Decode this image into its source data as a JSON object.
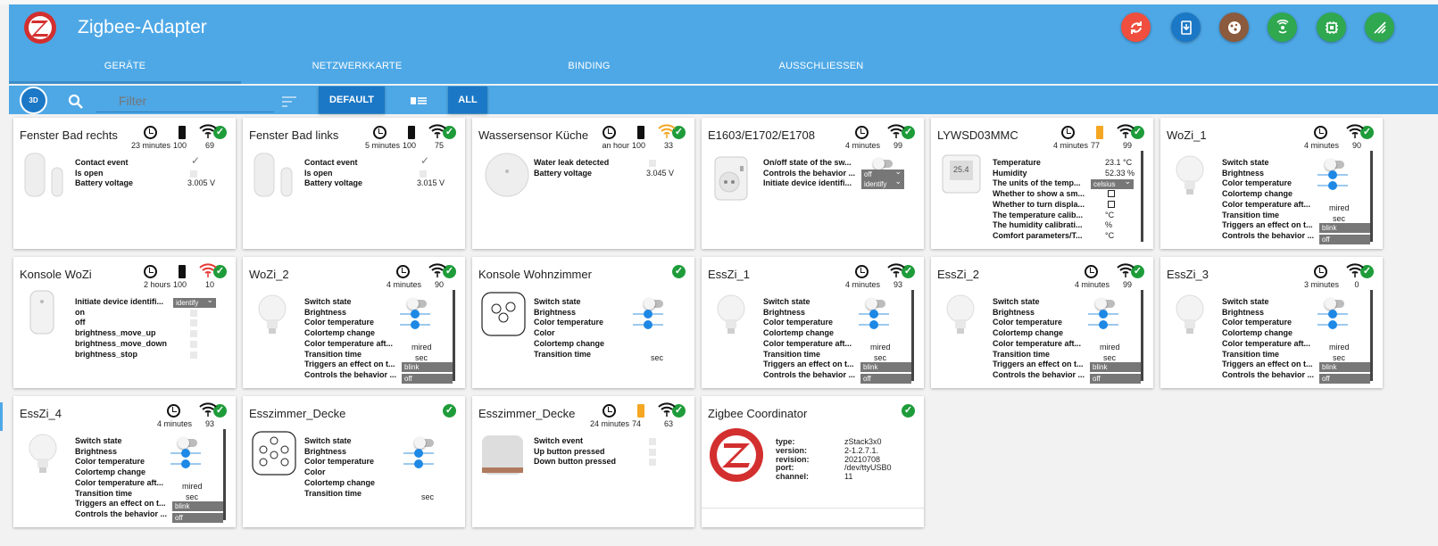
{
  "app": {
    "title": "Zigbee-Adapter"
  },
  "tabs": [
    "GERÄTE",
    "NETZWERKKARTE",
    "BINDING",
    "AUSSCHLIESSEN"
  ],
  "header_buttons": [
    {
      "name": "refresh-button",
      "icon": "refresh-icon",
      "color": "#f04e3e"
    },
    {
      "name": "install-button",
      "icon": "download-device-icon",
      "color": "#1b78c6"
    },
    {
      "name": "cookie-button",
      "icon": "cookie-icon",
      "color": "#8c5a3c"
    },
    {
      "name": "pairing-button",
      "icon": "pairing-icon",
      "color": "#2fa84f"
    },
    {
      "name": "chip-button",
      "icon": "chip-icon",
      "color": "#2fa84f"
    },
    {
      "name": "info-button",
      "icon": "signal-icon",
      "color": "#2fa84f"
    }
  ],
  "toolbar": {
    "filter_placeholder": "Filter",
    "default_label": "DEFAULT",
    "all_label": "ALL",
    "cube_label": "3D"
  },
  "colors": {
    "header": "#4ea8e6",
    "button": "#1b78c6",
    "ok": "#1e9c3a",
    "battery_low": "#f5a623",
    "wifi_orange": "#f5a623",
    "wifi_red": "#e53935"
  },
  "cards": [
    {
      "name": "Fenster Bad rechts",
      "status_time": "23 minutes",
      "battery": "100",
      "link": "69",
      "wifi_color": "#111",
      "battery_color": "#111",
      "image": "contact",
      "states": [
        {
          "label": "Contact event",
          "kind": "check"
        },
        {
          "label": "Is open",
          "kind": "box"
        },
        {
          "label": "Battery voltage",
          "kind": "text",
          "value": "3.005 V"
        }
      ]
    },
    {
      "name": "Fenster Bad links",
      "status_time": "5 minutes",
      "battery": "100",
      "link": "75",
      "wifi_color": "#111",
      "battery_color": "#111",
      "image": "contact",
      "states": [
        {
          "label": "Contact event",
          "kind": "check"
        },
        {
          "label": "Is open",
          "kind": "box"
        },
        {
          "label": "Battery voltage",
          "kind": "text",
          "value": "3.015 V"
        }
      ]
    },
    {
      "name": "Wassersensor Küche",
      "status_time": "an hour",
      "battery": "100",
      "link": "33",
      "wifi_color": "#f5a623",
      "battery_color": "#111",
      "image": "water",
      "states": [
        {
          "label": "Water leak detected",
          "kind": "box"
        },
        {
          "label": "Battery voltage",
          "kind": "text",
          "value": "3.045 V"
        }
      ]
    },
    {
      "name": "E1603/E1702/E1708",
      "status_time": "4 minutes",
      "battery": "",
      "link": "99",
      "wifi_color": "#111",
      "battery_color": "",
      "image": "plug",
      "states": [
        {
          "label": "On/off state of the sw...",
          "kind": "toggle"
        },
        {
          "label": "Controls the behavior ...",
          "kind": "select",
          "value": "off"
        },
        {
          "label": "Initiate device identifi...",
          "kind": "select",
          "value": "identify"
        }
      ]
    },
    {
      "name": "LYWSD03MMC",
      "status_time": "4 minutes",
      "battery": "77",
      "link": "99",
      "wifi_color": "#111",
      "battery_color": "#f5a623",
      "image": "thermo",
      "states": [
        {
          "label": "Temperature",
          "kind": "text",
          "value": "23.1 °C"
        },
        {
          "label": "Humidity",
          "kind": "text",
          "value": "52.33 %"
        },
        {
          "label": "The units of the temp...",
          "kind": "select",
          "value": "celsius"
        },
        {
          "label": "Whether to show a sm...",
          "kind": "cb"
        },
        {
          "label": "Whether to turn displa...",
          "kind": "cb"
        },
        {
          "label": "The temperature calib...",
          "kind": "text",
          "value": "°C"
        },
        {
          "label": "The humidity calibrati...",
          "kind": "text",
          "value": "%"
        },
        {
          "label": "Comfort parameters/T...",
          "kind": "text",
          "value": "°C"
        }
      ]
    },
    {
      "name": "WoZi_1",
      "status_time": "4 minutes",
      "battery": "",
      "link": "90",
      "wifi_color": "#111",
      "battery_color": "",
      "image": "bulb",
      "states": "bulb"
    },
    {
      "name": "Konsole WoZi",
      "status_time": "2 hours",
      "battery": "100",
      "link": "10",
      "wifi_color": "#e53935",
      "battery_color": "#111",
      "image": "remote",
      "states": [
        {
          "label": "Initiate device identifi...",
          "kind": "select",
          "value": "identify"
        },
        {
          "label": "on",
          "kind": "box"
        },
        {
          "label": "off",
          "kind": "box"
        },
        {
          "label": "brightness_move_up",
          "kind": "box"
        },
        {
          "label": "brightness_move_down",
          "kind": "box"
        },
        {
          "label": "brightness_stop",
          "kind": "box"
        }
      ]
    },
    {
      "name": "WoZi_2",
      "status_time": "4 minutes",
      "battery": "",
      "link": "90",
      "wifi_color": "#111",
      "battery_color": "",
      "image": "bulb",
      "states": "bulb"
    },
    {
      "name": "Konsole Wohnzimmer",
      "status_time": "",
      "battery": "",
      "link": "",
      "wifi_color": "",
      "battery_color": "",
      "image": "group",
      "states": "group"
    },
    {
      "name": "EssZi_1",
      "status_time": "4 minutes",
      "battery": "",
      "link": "93",
      "wifi_color": "#111",
      "battery_color": "",
      "image": "bulb",
      "states": "bulb"
    },
    {
      "name": "EssZi_2",
      "status_time": "4 minutes",
      "battery": "",
      "link": "99",
      "wifi_color": "#111",
      "battery_color": "",
      "image": "bulb",
      "states": "bulb"
    },
    {
      "name": "EssZi_3",
      "status_time": "3 minutes",
      "battery": "",
      "link": "0",
      "wifi_color": "#111",
      "battery_color": "",
      "image": "bulb",
      "states": "bulb"
    },
    {
      "name": "EssZi_4",
      "status_time": "4 minutes",
      "battery": "",
      "link": "93",
      "wifi_color": "#111",
      "battery_color": "",
      "image": "bulb",
      "states": "bulb"
    },
    {
      "name": "Esszimmer_Decke",
      "status_time": "",
      "battery": "",
      "link": "",
      "wifi_color": "",
      "battery_color": "",
      "image": "group2",
      "states": "group"
    },
    {
      "name": "Esszimmer_Decke",
      "status_time": "24 minutes",
      "battery": "74",
      "link": "63",
      "wifi_color": "#111",
      "battery_color": "#f5a623",
      "image": "button",
      "states": [
        {
          "label": "Switch event",
          "kind": "box"
        },
        {
          "label": "Up button pressed",
          "kind": "box"
        },
        {
          "label": "Down button pressed",
          "kind": "box"
        }
      ]
    },
    {
      "name": "Zigbee Coordinator",
      "status_time": "",
      "battery": "",
      "link": "",
      "wifi_color": "",
      "battery_color": "",
      "image": "coord",
      "states": "coord"
    }
  ],
  "bulb_states": {
    "labels": [
      "Switch state",
      "Brightness",
      "Color temperature",
      "Colortemp change",
      "Color temperature aft...",
      "Transition time",
      "Triggers an effect on t...",
      "Controls the behavior ..."
    ],
    "mired": "mired",
    "sec": "sec",
    "effect": "blink",
    "behavior": "off"
  },
  "group_states": {
    "labels": [
      "Switch state",
      "Brightness",
      "Color temperature",
      "Color",
      "Colortemp change",
      "Transition time"
    ],
    "sec": "sec"
  },
  "coordinator": {
    "keys": [
      "type:",
      "version:",
      "revision:",
      "port:",
      "channel:"
    ],
    "values": [
      "zStack3x0",
      "2-1.2.7.1.",
      "20210708",
      "/dev/ttyUSB0",
      "11"
    ]
  }
}
